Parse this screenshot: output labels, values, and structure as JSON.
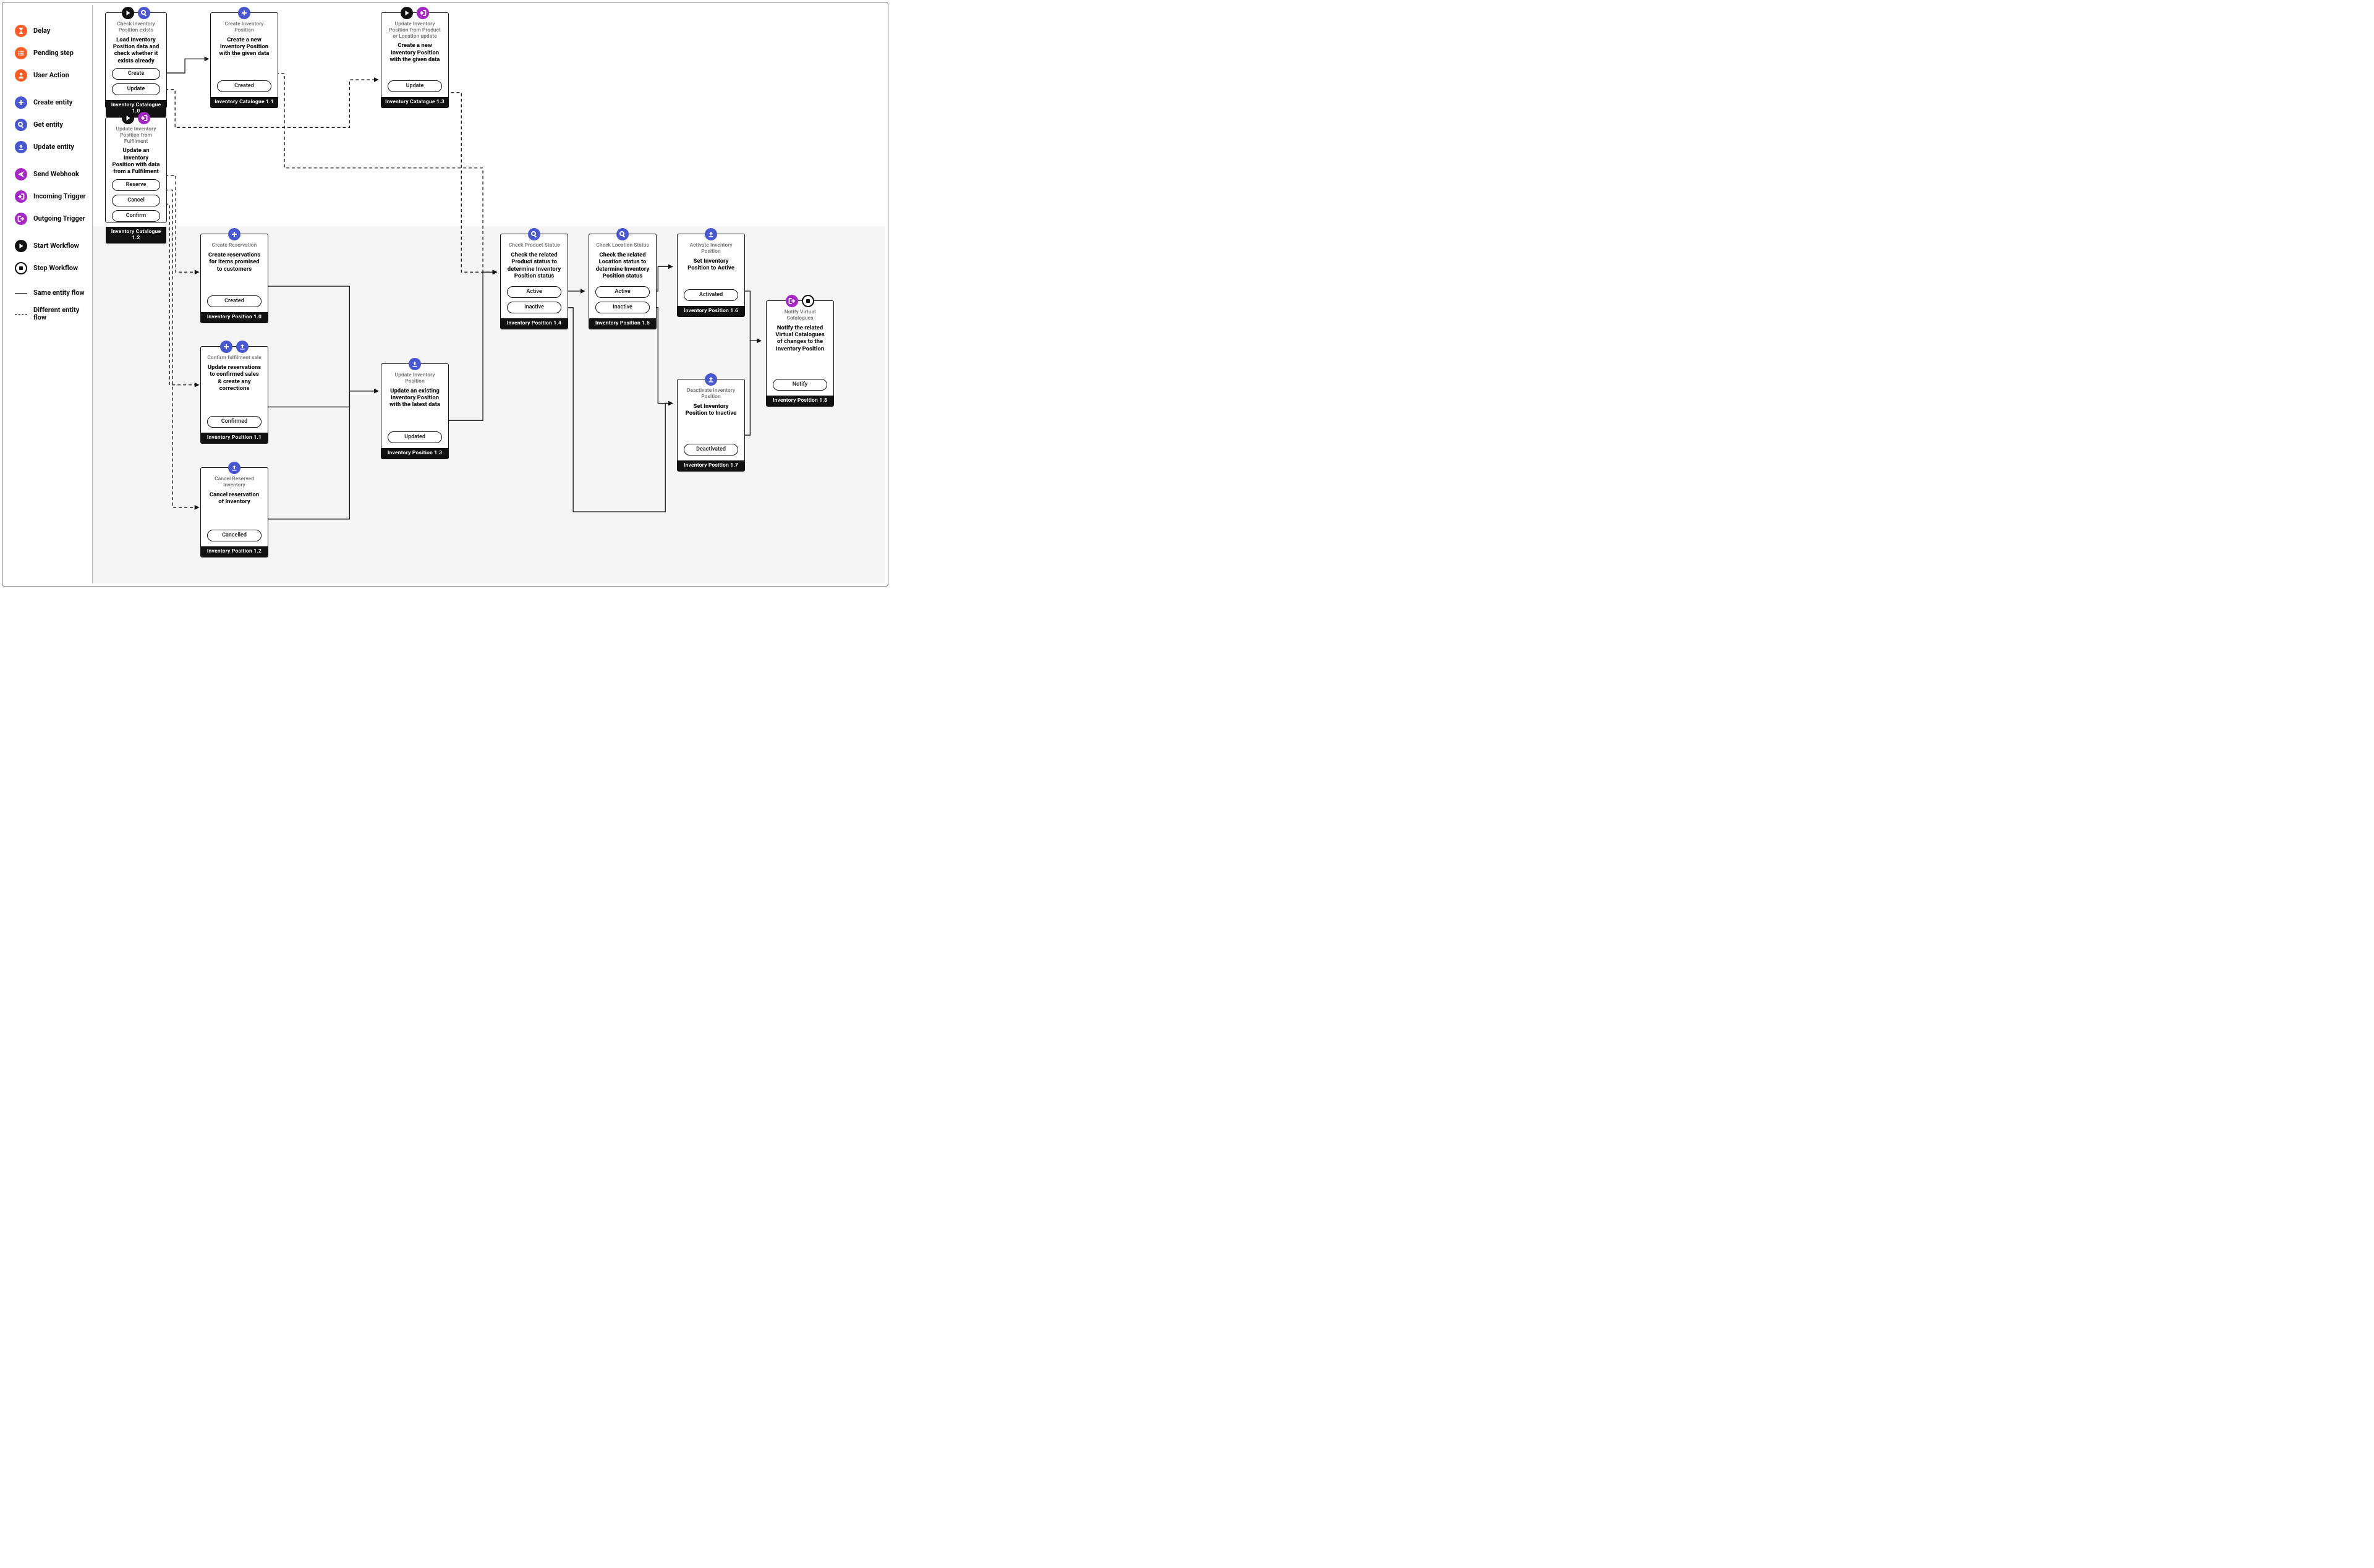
{
  "colors": {
    "orange": "#ff5c26",
    "blue": "#4a57d3",
    "purple": "#a626c6",
    "black": "#111111"
  },
  "legend": {
    "delay": "Delay",
    "pending_step": "Pending step",
    "user_action": "User Action",
    "create_entity": "Create entity",
    "get_entity": "Get entity",
    "update_entity": "Update entity",
    "send_webhook": "Send Webhook",
    "incoming_trigger": "Incoming Trigger",
    "outgoing_trigger": "Outgoing Trigger",
    "start_workflow": "Start Workflow",
    "stop_workflow": "Stop Workflow",
    "same_entity_flow": "Same entity flow",
    "different_entity_flow": "Different entity flow"
  },
  "nodes": {
    "ic10": {
      "title": "Check Inventory Position exists",
      "desc": "Load Inventory Position data and check whether it exists already",
      "buttons": [
        "Create",
        "Update"
      ],
      "footer": "Inventory Catalogue 1.0"
    },
    "ic11": {
      "title": "Create Inventory Position",
      "desc": "Create a new Inventory Position with the given data",
      "buttons": [
        "Created"
      ],
      "footer": "Inventory Catalogue 1.1"
    },
    "ic12": {
      "title": "Update Inventory Position from Fulfilment",
      "desc": "Update an Inventory Position with data from a Fulfilment",
      "buttons": [
        "Reserve",
        "Cancel",
        "Confirm"
      ],
      "footer": "Inventory Catalogue 1.2"
    },
    "ic13": {
      "title": "Update Inventory Position from Product or Location update",
      "desc": "Create a new Inventory Position with the given data",
      "buttons": [
        "Update"
      ],
      "footer": "Inventory Catalogue 1.3"
    },
    "ip10": {
      "title": "Create Reservation",
      "desc": "Create reservations for items promised to customers",
      "buttons": [
        "Created"
      ],
      "footer": "Inventory Position 1.0"
    },
    "ip11": {
      "title": "Confirm fulfilment sale",
      "desc": "Update reservations to confirmed sales & create any corrections",
      "buttons": [
        "Confirmed"
      ],
      "footer": "Inventory Position 1.1"
    },
    "ip12": {
      "title": "Cancel Reserved Inventory",
      "desc": "Cancel reservation of Inventory",
      "buttons": [
        "Cancelled"
      ],
      "footer": "Inventory Position 1.2"
    },
    "ip13": {
      "title": "Update Inventory Position",
      "desc": "Update an existing Inventory Position with the latest data",
      "buttons": [
        "Updated"
      ],
      "footer": "Inventory Position 1.3"
    },
    "ip14": {
      "title": "Check Product Status",
      "desc": "Check the related Product status to determine Inventory Position status",
      "buttons": [
        "Active",
        "Inactive"
      ],
      "footer": "Inventory Position 1.4"
    },
    "ip15": {
      "title": "Check Location Status",
      "desc": "Check the related Location status to determine Inventory Position status",
      "buttons": [
        "Active",
        "Inactive"
      ],
      "footer": "Inventory Position 1.5"
    },
    "ip16": {
      "title": "Activate Inventory Position",
      "desc": "Set Inventory Position to Active",
      "buttons": [
        "Activated"
      ],
      "footer": "Inventory Position 1.6"
    },
    "ip17": {
      "title": "Deactivate Inventory Position",
      "desc": "Set Inventory Position to Inactive",
      "buttons": [
        "Deactivated"
      ],
      "footer": "Inventory Position 1.7"
    },
    "ip18": {
      "title": "Notify Virtual Catalogues",
      "desc": "Notify the related Virtual Catalogues of changes to the Inventory Position",
      "buttons": [
        "Notify"
      ],
      "footer": "Inventory Position 1.8"
    }
  }
}
